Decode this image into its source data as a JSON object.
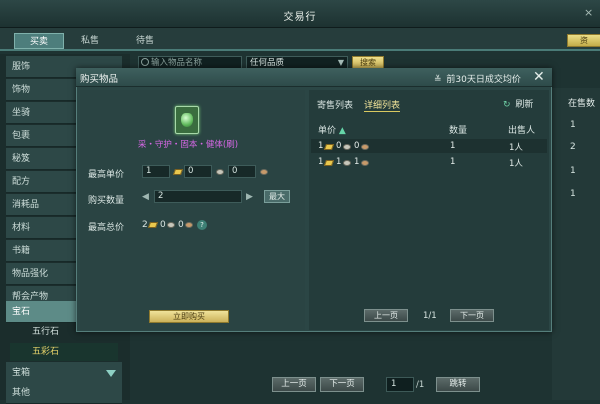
{
  "window": {
    "title": "交易行",
    "close": "×"
  },
  "tabs": [
    {
      "label": "买卖",
      "active": true
    },
    {
      "label": "私售",
      "active": false
    },
    {
      "label": "待售",
      "active": false
    }
  ],
  "top_right_button": "资",
  "search": {
    "placeholder": "输入物品名称",
    "quality": "任何品质",
    "button": "搜索"
  },
  "categories": [
    "服饰",
    "饰物",
    "坐骑",
    "包裹",
    "秘笈",
    "配方",
    "消耗品",
    "材料",
    "书籍",
    "物品强化",
    "帮会产物",
    "宝石"
  ],
  "subcategories": [
    {
      "label": "五行石",
      "selected": false
    },
    {
      "label": "五彩石",
      "selected": true
    }
  ],
  "bottom_categories": [
    "宝箱",
    "其他"
  ],
  "right_column": {
    "header": "在售数",
    "values": [
      "1",
      "2",
      "1",
      "1"
    ]
  },
  "paging": {
    "prev": "上一页",
    "next": "下一页",
    "current": "1",
    "total": "/1",
    "jump": "跳转"
  },
  "dialog": {
    "title": "购买物品",
    "history_label": "前30天日成交均价",
    "close": "✕",
    "item_name": "采・守护・固本・健体(刷)",
    "max_price_label": "最高单价",
    "max_price": {
      "gold": "1",
      "silver": "0",
      "copper": "0"
    },
    "quantity_label": "购买数量",
    "quantity": "2",
    "max_button": "最大",
    "total_label": "最高总价",
    "total": {
      "gold": "2",
      "silver": "0",
      "copper": "0"
    },
    "help": "?",
    "buy_button": "立即购买",
    "list_tabs": [
      "寄售列表",
      "详细列表"
    ],
    "refresh": "刷新",
    "columns": {
      "price": "单价",
      "qty": "数量",
      "seller": "出售人"
    },
    "rows": [
      {
        "gold": "1",
        "silver": "0",
        "copper": "0",
        "qty": "1",
        "seller": "1人"
      },
      {
        "gold": "1",
        "silver": "1",
        "copper": "1",
        "qty": "1",
        "seller": "1人"
      }
    ],
    "paging": {
      "prev": "上一页",
      "page": "1/1",
      "next": "下一页"
    }
  }
}
